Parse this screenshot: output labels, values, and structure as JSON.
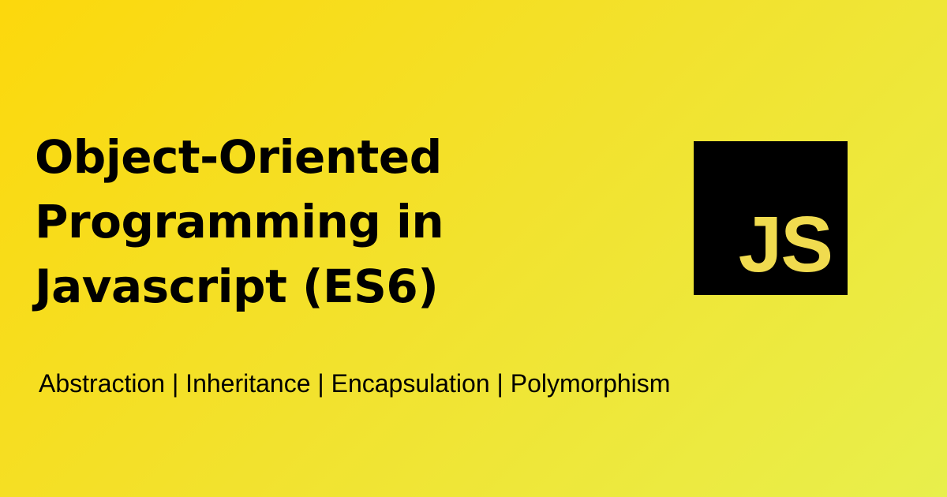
{
  "title": {
    "line1": "Object-Oriented",
    "line2": "Programming in",
    "line3": "Javascript (ES6)"
  },
  "subtitle": "Abstraction | Inheritance | Encapsulation | Polymorphism",
  "logo": {
    "text": "JS",
    "icon": "javascript-logo-icon"
  },
  "colors": {
    "background_start": "#fcd80c",
    "background_end": "#e8ef4c",
    "text": "#000000",
    "logo_background": "#000000",
    "logo_text": "#f0db4f"
  }
}
